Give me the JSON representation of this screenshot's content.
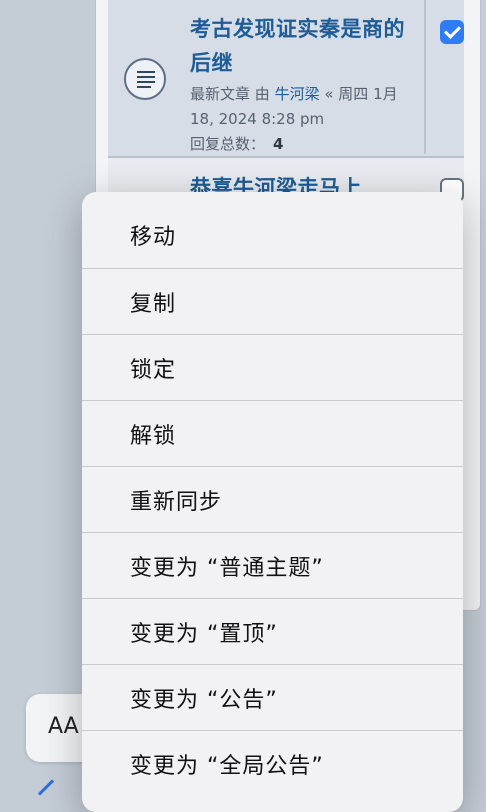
{
  "topic": {
    "title": "考古发现证实秦是商的后继",
    "meta_line": "最新文章 由",
    "author": "牛河梁",
    "date": "« 周四 1月 18, 2024 8:28 pm",
    "replies_label": "回复总数：",
    "replies_count": "4",
    "selected": true
  },
  "topic2": {
    "title": "恭喜牛河梁走马上",
    "selected": false
  },
  "menu": {
    "items": [
      {
        "label": "移动"
      },
      {
        "label": "复制"
      },
      {
        "label": "锁定"
      },
      {
        "label": "解锁"
      },
      {
        "label": "重新同步"
      },
      {
        "label": "变更为 “普通主题”"
      },
      {
        "label": "变更为 “置顶”"
      },
      {
        "label": "变更为 “公告”"
      },
      {
        "label": "变更为 “全局公告”"
      }
    ]
  },
  "toolbar": {
    "text_size_label": "AA"
  },
  "colors": {
    "link": "#1e5c97",
    "checkbox_accent": "#2e7cf6",
    "menu_bg": "#f2f2f4"
  }
}
